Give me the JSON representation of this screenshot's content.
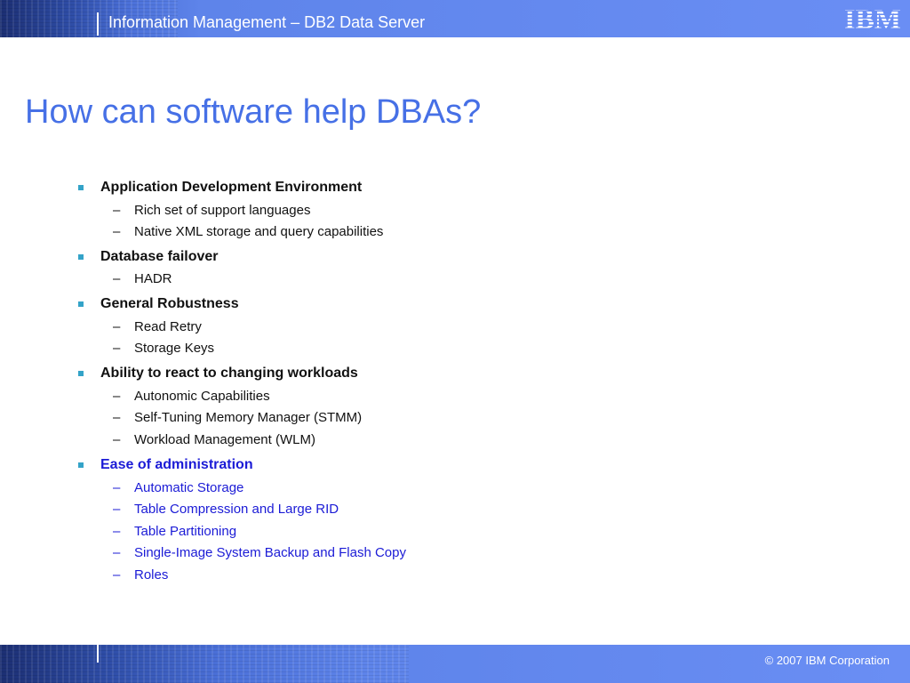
{
  "header": {
    "title": "Information Management – DB2 Data Server",
    "logo_text": "IBM"
  },
  "slide": {
    "title": "How can software help DBAs?",
    "dash_glyph": "–",
    "bullets": [
      {
        "label": "Application Development Environment",
        "sub": [
          "Rich set of support languages",
          "Native XML storage and query capabilities"
        ]
      },
      {
        "label": "Database failover",
        "sub": [
          "HADR"
        ]
      },
      {
        "label": "General Robustness",
        "sub": [
          "Read Retry",
          "Storage Keys"
        ]
      },
      {
        "label": "Ability to react to changing workloads",
        "sub": [
          "Autonomic Capabilities",
          "Self-Tuning Memory Manager (STMM)",
          "Workload Management (WLM)"
        ]
      },
      {
        "label": "Ease of administration",
        "highlighted": true,
        "sub": [
          "Automatic Storage",
          "Table Compression and Large RID",
          "Table Partitioning",
          "Single-Image System Backup and Flash Copy",
          "Roles"
        ]
      }
    ]
  },
  "footer": {
    "copyright": "© 2007 IBM Corporation"
  },
  "colors": {
    "title": "#4670e6",
    "highlight": "#1b1bd6",
    "bullet": "#34a3c8",
    "bar": "#6a8ef4"
  }
}
